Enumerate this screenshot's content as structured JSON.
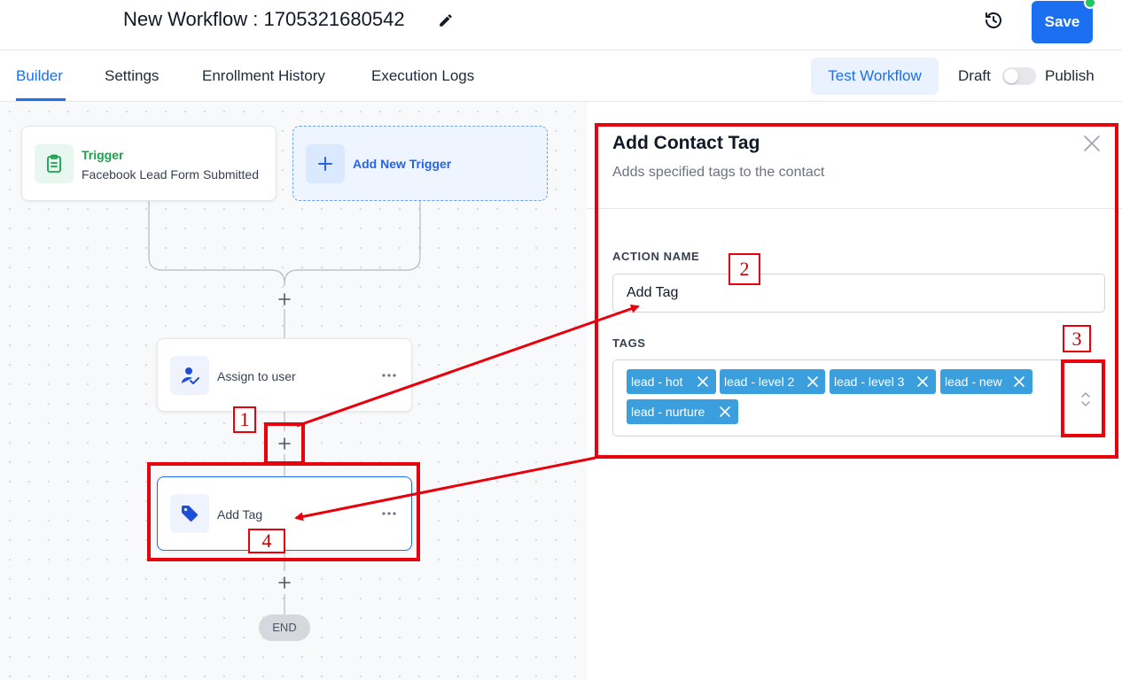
{
  "header": {
    "workflow_title": "New Workflow : 1705321680542",
    "save_label": "Save"
  },
  "tabs": [
    {
      "label": "Builder",
      "active": true
    },
    {
      "label": "Settings",
      "active": false
    },
    {
      "label": "Enrollment History",
      "active": false
    },
    {
      "label": "Execution Logs",
      "active": false
    }
  ],
  "toolbar": {
    "test_label": "Test Workflow",
    "draft_label": "Draft",
    "publish_label": "Publish"
  },
  "canvas": {
    "trigger": {
      "title": "Trigger",
      "subtitle": "Facebook Lead Form Submitted"
    },
    "add_trigger_label": "Add New Trigger",
    "steps": [
      {
        "label": "Assign to user",
        "icon": "user-check-icon"
      },
      {
        "label": "Add Tag",
        "icon": "tag-icon"
      }
    ],
    "end_label": "END"
  },
  "panel": {
    "title": "Add Contact Tag",
    "description": "Adds specified tags to the contact",
    "action_name_label": "ACTION NAME",
    "action_name_value": "Add Tag",
    "tags_label": "TAGS",
    "tags": [
      "lead - hot",
      "lead - level 2",
      "lead - level 3",
      "lead - new",
      "lead - nurture"
    ]
  },
  "annotations": [
    "1",
    "2",
    "3",
    "4"
  ],
  "colors": {
    "accent": "#1d6ff2",
    "tag_chip": "#3b9fde",
    "annotation_red": "#e8000c",
    "trigger_green": "#16a34a"
  }
}
